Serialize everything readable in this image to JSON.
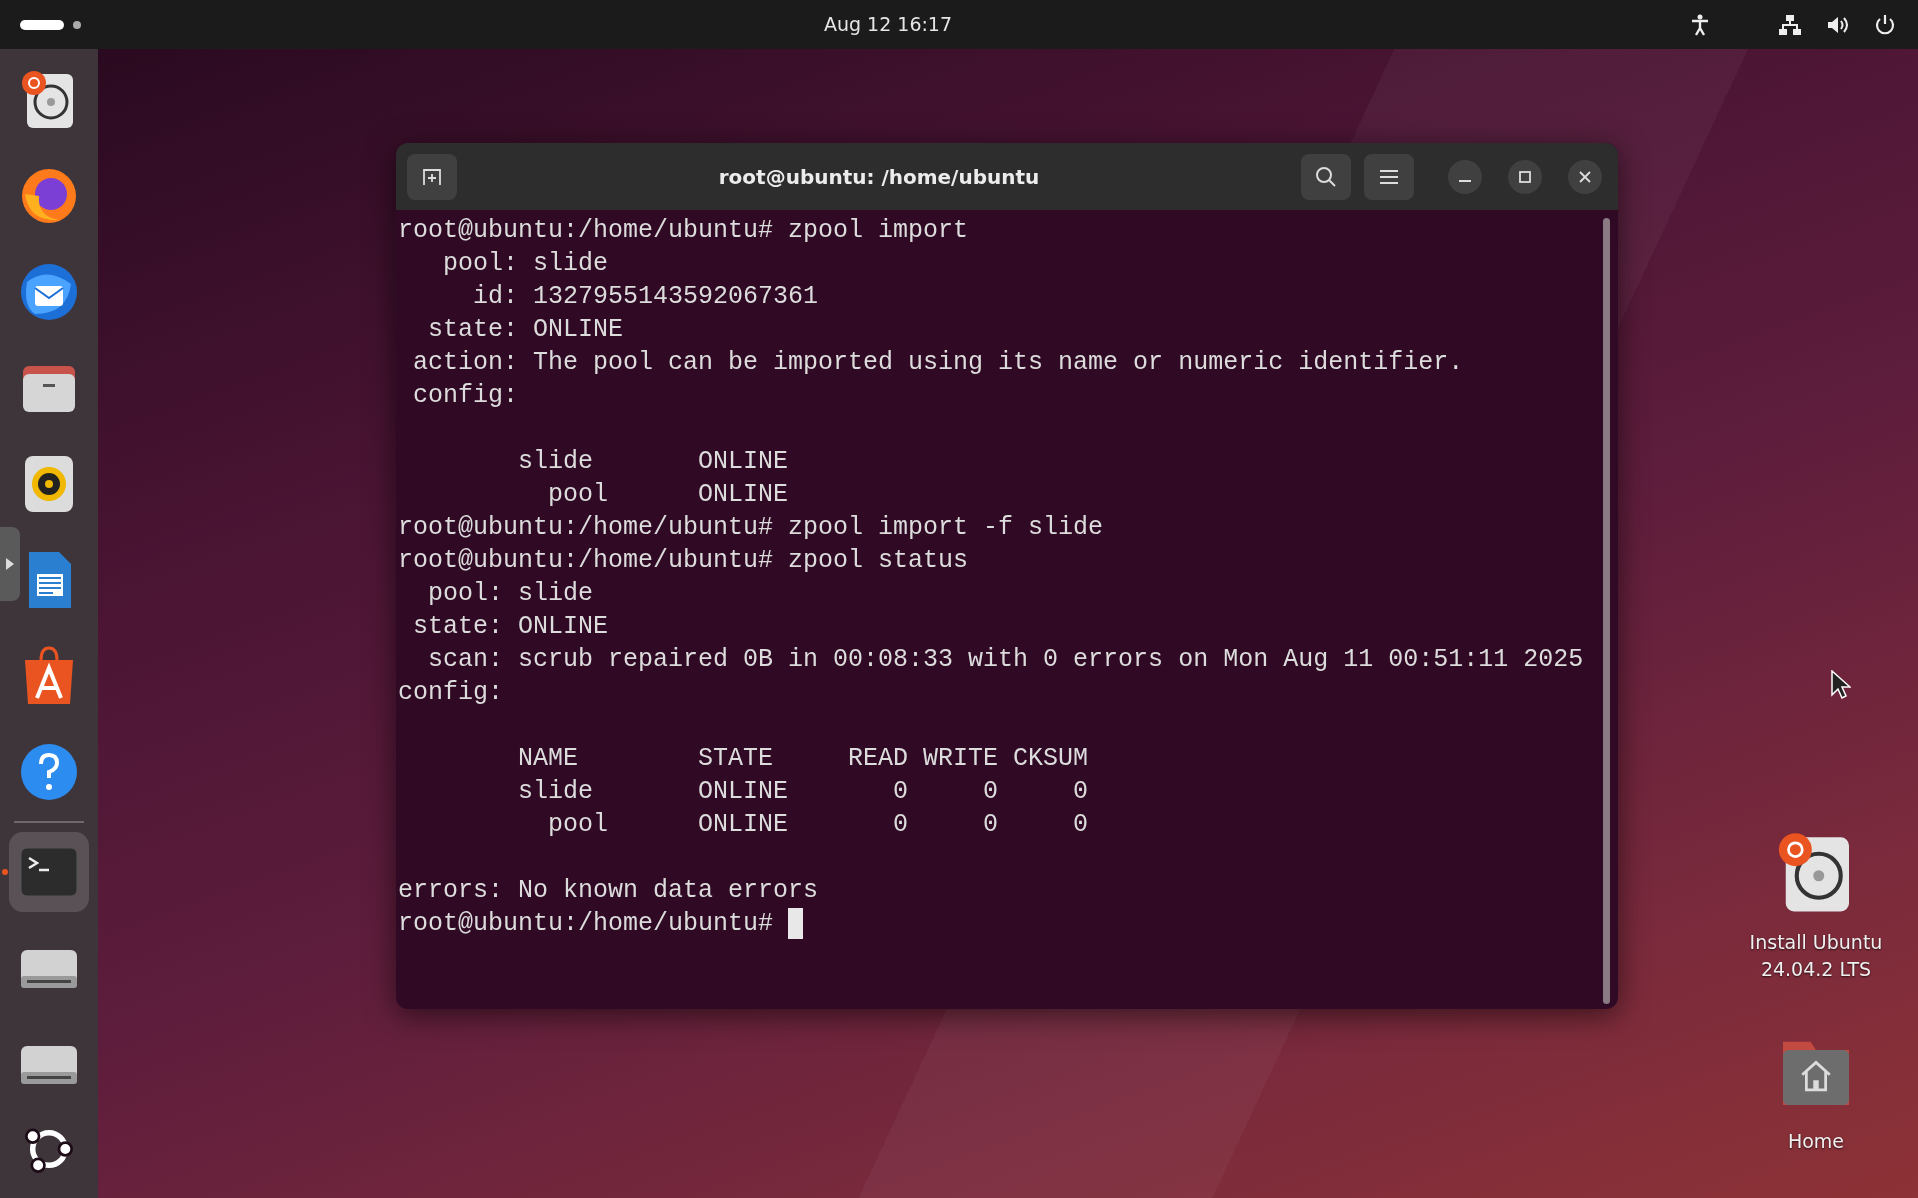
{
  "top_bar": {
    "clock": "Aug 12  16:17"
  },
  "dock": {
    "items": [
      {
        "kind": "installer",
        "running": false
      },
      {
        "kind": "firefox",
        "running": false
      },
      {
        "kind": "mail",
        "running": false
      },
      {
        "kind": "files",
        "running": false
      },
      {
        "kind": "music",
        "running": false
      },
      {
        "kind": "writer",
        "running": false
      },
      {
        "kind": "appstore",
        "running": false
      },
      {
        "kind": "help",
        "running": false
      },
      {
        "kind": "terminal",
        "running": true
      },
      {
        "kind": "drive",
        "running": false
      },
      {
        "kind": "drive",
        "running": false
      }
    ]
  },
  "terminal": {
    "title": "root@ubuntu: /home/ubuntu",
    "lines": [
      {
        "text": "root@ubuntu:/home/ubuntu# zpool import",
        "cursor": false
      },
      {
        "text": "   pool: slide",
        "cursor": false
      },
      {
        "text": "     id: 1327955143592067361",
        "cursor": false
      },
      {
        "text": "  state: ONLINE",
        "cursor": false
      },
      {
        "text": " action: The pool can be imported using its name or numeric identifier.",
        "cursor": false
      },
      {
        "text": " config:",
        "cursor": false
      },
      {
        "cursor": false
      },
      {
        "text": "        slide       ONLINE",
        "cursor": false
      },
      {
        "text": "          pool      ONLINE",
        "cursor": false
      },
      {
        "text": "root@ubuntu:/home/ubuntu# zpool import -f slide",
        "cursor": false
      },
      {
        "text": "root@ubuntu:/home/ubuntu# zpool status",
        "cursor": false
      },
      {
        "text": "  pool: slide",
        "cursor": false
      },
      {
        "text": " state: ONLINE",
        "cursor": false
      },
      {
        "text": "  scan: scrub repaired 0B in 00:08:33 with 0 errors on Mon Aug 11 00:51:11 2025",
        "cursor": false
      },
      {
        "text": "config:",
        "cursor": false
      },
      {
        "cursor": false
      },
      {
        "text": "        NAME        STATE     READ WRITE CKSUM",
        "cursor": false
      },
      {
        "text": "        slide       ONLINE       0     0     0",
        "cursor": false
      },
      {
        "text": "          pool      ONLINE       0     0     0",
        "cursor": false
      },
      {
        "cursor": false
      },
      {
        "text": "errors: No known data errors",
        "cursor": false
      },
      {
        "text": "root@ubuntu:/home/ubuntu# ",
        "cursor": true
      }
    ]
  },
  "desktop_icons": [
    {
      "kind": "installer",
      "label": "Install Ubuntu 24.04.2 LTS"
    },
    {
      "kind": "home",
      "label": "Home"
    }
  ]
}
